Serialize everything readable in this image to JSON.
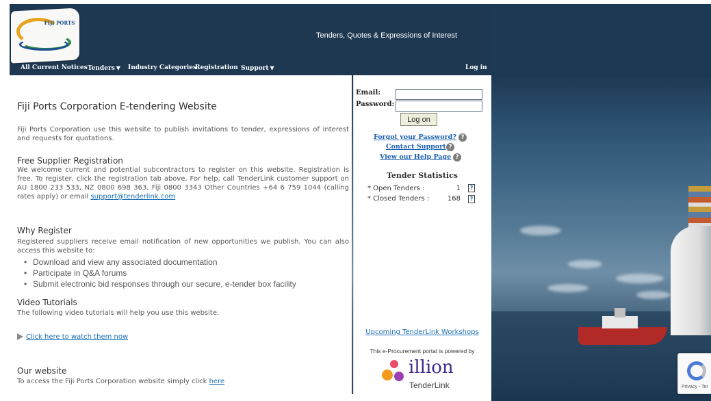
{
  "header": {
    "logo_text": "FIJI PORTS",
    "tagline": "Tenders, Quotes & Expressions of Interest"
  },
  "nav": {
    "items": [
      {
        "label": "All Current Notices",
        "dropdown": false
      },
      {
        "label": "Tenders",
        "dropdown": true
      },
      {
        "label": "Industry Categories",
        "dropdown": false
      },
      {
        "label": "Registration",
        "dropdown": false
      },
      {
        "label": "Support",
        "dropdown": true
      }
    ],
    "login": "Log in"
  },
  "main": {
    "title": "Fiji Ports Corporation E-tendering Website",
    "intro": "Fiji Ports Corporation use this website to publish invitations to tender, expressions of interest and requests for quotations.",
    "free_title": "Free Supplier Registration",
    "free_text": "We welcome current and potential subcontractors to register on this website. Registration is free. To register, click the registration tab above. For help, call TenderLink customer support on AU 1800 233 533, NZ 0800 698 363, Fiji 0800 3343 Other Countries +64 6 759 1044 (calling rates apply)  or email ",
    "support_email": "support@tenderlink.com",
    "why_title": "Why Register",
    "why_text": "Registered suppliers receive email notification of new opportunities we publish. You can also access this website to:",
    "why_bullets": [
      "Download and view any associated documentation",
      "Participate in Q&A forums",
      "Submit electronic bid responses through our secure, e-tender box facility"
    ],
    "video_title": "Video Tutorials",
    "video_text": "The following video tutorials will help you use this website.",
    "video_link": "Click here to watch them now",
    "website_title": "Our website",
    "website_text": "To access the Fiji Ports Corporation website simply click ",
    "website_link": "here"
  },
  "login": {
    "email_label": "Email:",
    "password_label": "Password:",
    "email_value": "",
    "password_value": "",
    "button": "Log on",
    "forgot": "Forgot your Password?",
    "contact": "Contact Support",
    "help": "View our Help Page"
  },
  "stats": {
    "title": "Tender Statistics",
    "open_label": "* Open Tenders :",
    "open_count": "1",
    "closed_label": "* Closed Tenders :",
    "closed_count": "168"
  },
  "sidebar_footer": {
    "workshops": "Upcoming TenderLink Workshops",
    "powered": "This e-Procurement portal is powered by",
    "brand": "illion",
    "brand_sub": "TenderLink"
  },
  "captcha": {
    "text": "Privacy - Ter"
  },
  "colors": {
    "header_bg": "#1e3852",
    "link": "#1a6fb5",
    "brand_purple": "#3f2a8c"
  }
}
